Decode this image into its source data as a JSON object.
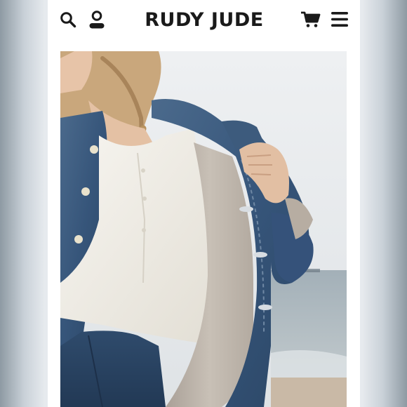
{
  "header": {
    "brand": "RUDY JUDE",
    "icons": {
      "search": "search-icon",
      "account": "account-icon",
      "cart": "cart-icon",
      "menu": "menu-icon"
    }
  },
  "colors": {
    "ink": "#1a1a1a",
    "denim": "#3a5675",
    "shirt": "#f3f1ea",
    "lining": "#bdb5aa",
    "sky": "#e8ebee",
    "sea": "#9aa8b2"
  },
  "hero": {
    "image": "woman-in-sherpa-lined-denim-jacket"
  }
}
